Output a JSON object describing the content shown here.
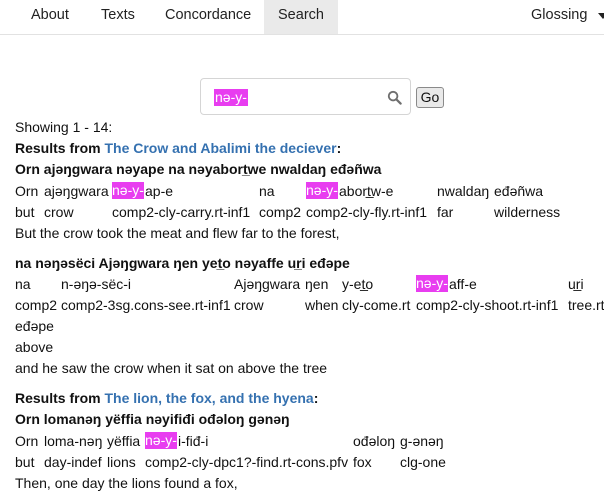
{
  "nav": {
    "about": "About",
    "texts": "Texts",
    "concordance": "Concordance",
    "search": "Search",
    "glossing": "Glossing"
  },
  "search": {
    "value": "nə-y-",
    "go_label": "Go"
  },
  "showing": "Showing 1 - 14:",
  "results_prefix": "Results from",
  "results_suffix": ":",
  "results": [
    {
      "source_title": "The Crow and Abalimi the deciever",
      "examples": [
        {
          "title": "Orn ajəŋgwara nəyape na nəyabort̲we nwaldaŋ eđəñwa",
          "line1": [
            "Orn",
            "ajəŋgwara",
            "nə-y-",
            "ap-e",
            "na",
            "nə-y-",
            "abort̲w-e",
            "nwaldaŋ",
            "eđəñwa"
          ],
          "line2": [
            "but",
            "crow",
            "comp2-cly-carry.rt-inf1",
            "comp2",
            "comp2-cly-fly.rt-inf1",
            "far",
            "wilderness"
          ],
          "translation": "But the crow took the meat and flew far to the forest,"
        },
        {
          "title": "na nəŋəsëci Ajəŋgwara ŋen yet̲o nəyaffe ur̲i eđəpe",
          "line1": [
            "na",
            "n-əŋə-sëc-i",
            "Ajəŋgwara",
            "ŋen",
            "y-et̲o",
            "nə-y-",
            "aff-e",
            "ur̲i"
          ],
          "line2": [
            "comp2",
            "comp2-3sg.cons-see.rt-inf1",
            "crow",
            "when",
            "cly-come.rt",
            "comp2-cly-shoot.rt-inf1",
            "tree.rt"
          ],
          "overflow_word": "eđəpe",
          "overflow_gloss": "above",
          "translation": "and he saw the crow when it sat on above the tree"
        }
      ]
    },
    {
      "source_title": "The lion, the fox, and the hyena",
      "examples": [
        {
          "title": "Orn lomanəŋ yëffia nəyifiđi ođəloŋ gənəŋ",
          "line1": [
            "Orn",
            "loma-nəŋ",
            "yëffia",
            "nə-y-",
            "i-fiđ-i",
            "ođəloŋ",
            "g-ənəŋ"
          ],
          "line2": [
            "but",
            "day-indef",
            "lions",
            "comp2-cly-dpc1?-find.rt-cons.pfv",
            "fox",
            "clg-one"
          ],
          "translation": "Then, one day the lions found a fox,"
        }
      ]
    }
  ]
}
